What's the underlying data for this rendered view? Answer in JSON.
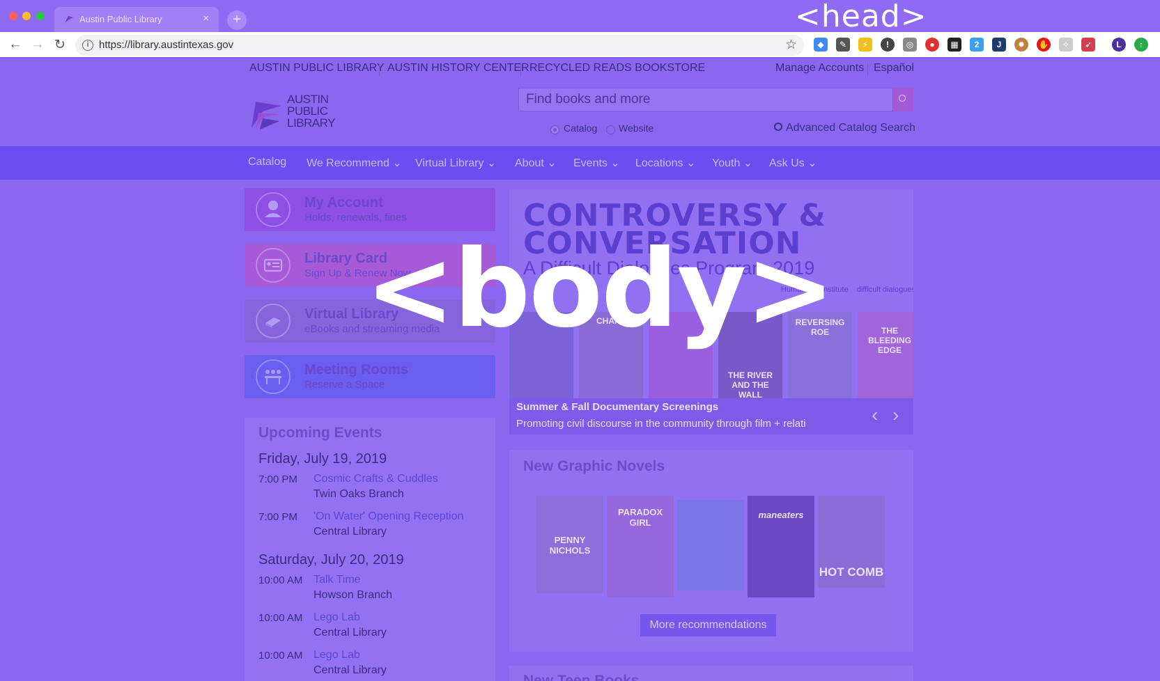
{
  "browser": {
    "tab_title": "Austin Public Library",
    "url": "https://library.austintexas.gov",
    "new_tab_symbol": "+",
    "tab_close_symbol": "×",
    "profile_initial": "L",
    "extension_badge": "2"
  },
  "overlay": {
    "head_label": "<head>",
    "body_label": "<body>"
  },
  "utility_nav": {
    "left": [
      "AUSTIN PUBLIC LIBRARY",
      "AUSTIN HISTORY CENTER",
      "RECYCLED READS BOOKSTORE"
    ],
    "right": [
      "Manage Accounts",
      "Español"
    ]
  },
  "logo": {
    "lines": [
      "AUSTIN",
      "PUBLIC",
      "LIBRARY"
    ]
  },
  "search": {
    "placeholder": "Find books and more",
    "options": [
      "Catalog",
      "Website"
    ],
    "selected": "Catalog",
    "advanced_label": "Advanced Catalog Search"
  },
  "main_nav": [
    "Catalog",
    "We Recommend",
    "Virtual Library",
    "About",
    "Events",
    "Locations",
    "Youth",
    "Ask Us"
  ],
  "tiles": [
    {
      "title": "My Account",
      "subtitle": "Holds, renewals, fines",
      "icon": "user-icon",
      "color": "#8d4fe4"
    },
    {
      "title": "Library Card",
      "subtitle": "Sign Up & Renew Now",
      "icon": "id-card-icon",
      "color": "#a65ad8"
    },
    {
      "title": "Virtual Library",
      "subtitle": "eBooks and streaming media",
      "icon": "book-icon",
      "color": "#8665dc"
    },
    {
      "title": "Meeting Rooms",
      "subtitle": "Reserve a Space",
      "icon": "meeting-icon",
      "color": "#6b5df0"
    }
  ],
  "events": {
    "title": "Upcoming Events",
    "days": [
      {
        "date": "Friday, July 19, 2019",
        "items": [
          {
            "time": "7:00 PM",
            "name": "Cosmic Crafts & Cuddles",
            "location": "Twin Oaks Branch"
          },
          {
            "time": "7:00 PM",
            "name": "'On Water' Opening Reception",
            "location": "Central Library"
          }
        ]
      },
      {
        "date": "Saturday, July 20, 2019",
        "items": [
          {
            "time": "10:00 AM",
            "name": "Talk Time",
            "location": "Howson Branch"
          },
          {
            "time": "10:00 AM",
            "name": "Lego Lab",
            "location": "Central Library"
          },
          {
            "time": "10:00 AM",
            "name": "Lego Lab",
            "location": "Central Library"
          }
        ]
      }
    ]
  },
  "carousel": {
    "headline": [
      "CONTROVERSY &",
      "CONVERSATION"
    ],
    "subhead": "A Difficult Dialogues Program 2019",
    "sponsors": [
      "Humanities Institute",
      "difficult dialogues"
    ],
    "posters": [
      "",
      "CHANT",
      "",
      "THE RIVER AND THE WALL",
      "REVERSING ROE",
      "THE BLEEDING EDGE"
    ],
    "caption_title": "Summer & Fall Documentary Screenings",
    "caption_text": "Promoting civil discourse in the community through film + relati",
    "prev_symbol": "‹",
    "next_symbol": "›"
  },
  "graphic_novels": {
    "title": "New Graphic Novels",
    "covers": [
      "PENNY NICHOLS",
      "PARADOX GIRL",
      "",
      "maneaters",
      "HOT COMB"
    ],
    "more_label": "More recommendations"
  },
  "teen_books": {
    "title": "New Teen Books"
  }
}
